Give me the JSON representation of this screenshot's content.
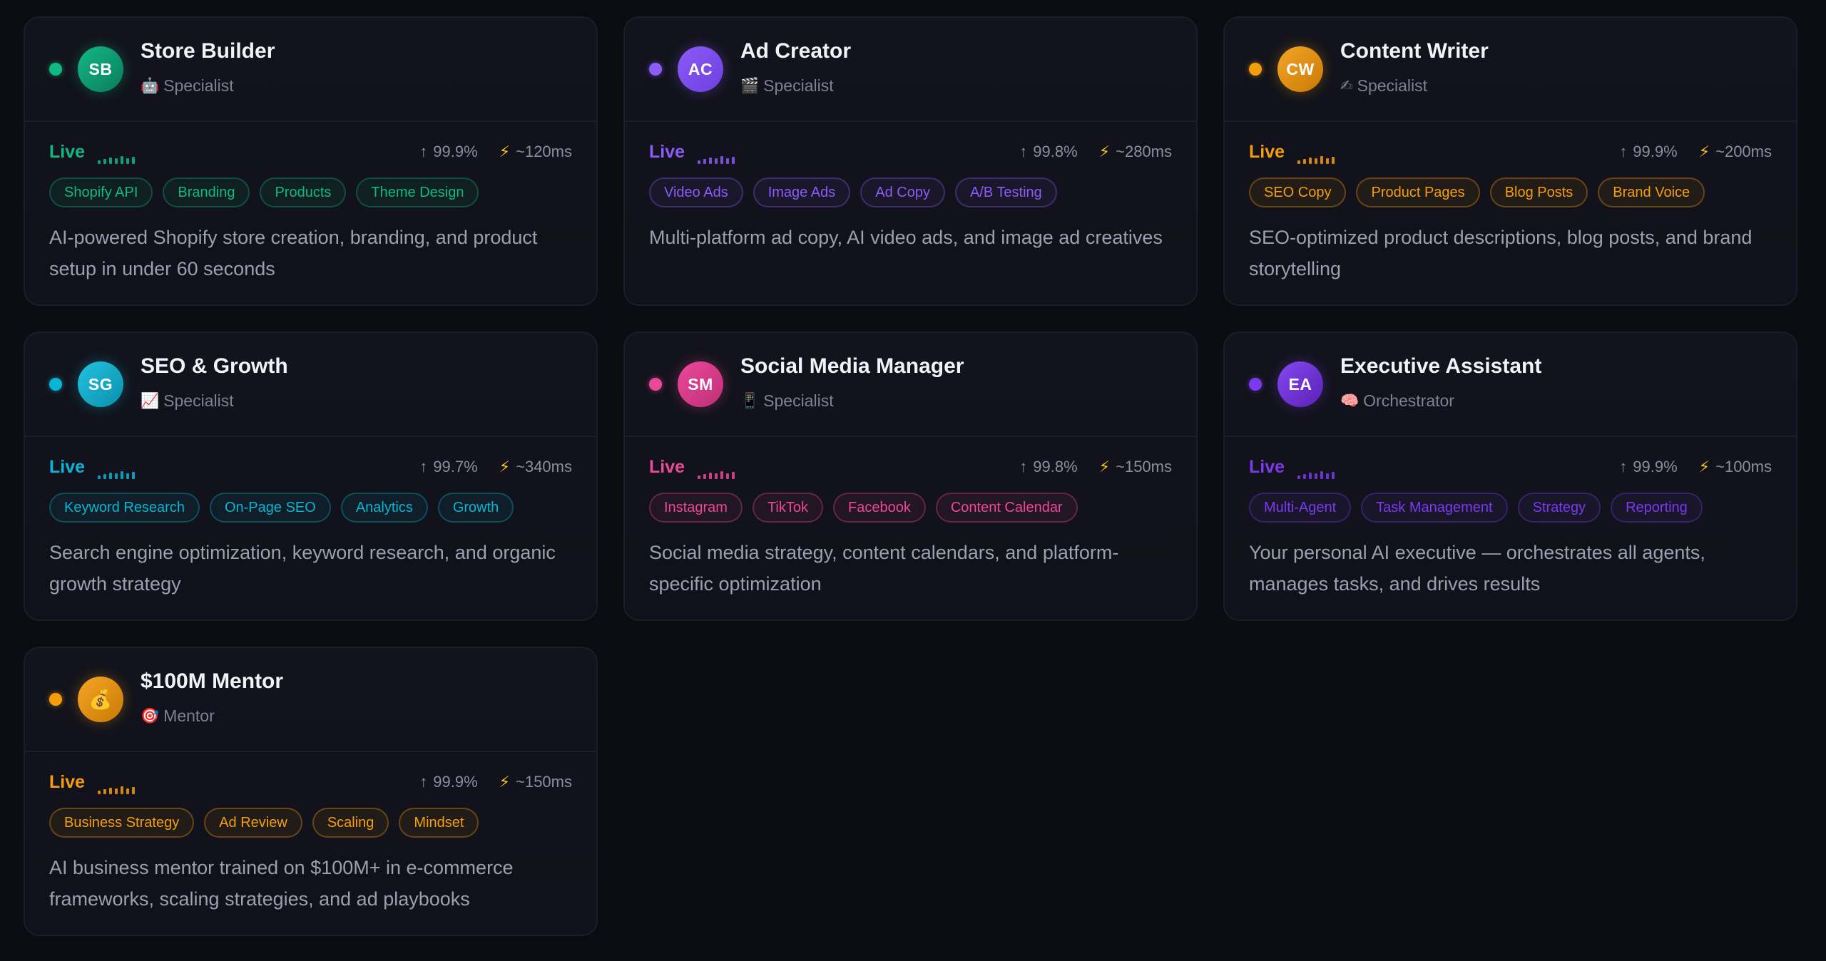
{
  "stat_live_label": "Live",
  "agents": [
    {
      "initials": "SB",
      "name": "Store Builder",
      "role": "Specialist",
      "role_icon": "robot-icon",
      "role_glyph": "🤖",
      "uptime": "99.9%",
      "latency": "~120ms",
      "accent": "#10b981",
      "avatar_from": "#12b886",
      "avatar_to": "#0a7d5c",
      "tags": [
        "Shopify API",
        "Branding",
        "Products",
        "Theme Design"
      ],
      "description": "AI-powered Shopify store creation, branding, and product setup in under 60 seconds"
    },
    {
      "initials": "AC",
      "name": "Ad Creator",
      "role": "Specialist",
      "role_icon": "clapperboard-icon",
      "role_glyph": "🎬",
      "uptime": "99.8%",
      "latency": "~280ms",
      "accent": "#8b5cf6",
      "avatar_from": "#8b5cf6",
      "avatar_to": "#6d3fe0",
      "tags": [
        "Video Ads",
        "Image Ads",
        "Ad Copy",
        "A/B Testing"
      ],
      "description": "Multi-platform ad copy, AI video ads, and image ad creatives"
    },
    {
      "initials": "CW",
      "name": "Content Writer",
      "role": "Specialist",
      "role_icon": "writing-hand-icon",
      "role_glyph": "✍",
      "uptime": "99.9%",
      "latency": "~200ms",
      "accent": "#f59e0b",
      "avatar_from": "#f5a524",
      "avatar_to": "#c97a06",
      "tags": [
        "SEO Copy",
        "Product Pages",
        "Blog Posts",
        "Brand Voice"
      ],
      "description": "SEO-optimized product descriptions, blog posts, and brand storytelling"
    },
    {
      "initials": "SG",
      "name": "SEO & Growth",
      "role": "Specialist",
      "role_icon": "chart-increasing-icon",
      "role_glyph": "📈",
      "uptime": "99.7%",
      "latency": "~340ms",
      "accent": "#06b6d4",
      "avatar_from": "#22c3dd",
      "avatar_to": "#0b8fb0",
      "tags": [
        "Keyword Research",
        "On-Page SEO",
        "Analytics",
        "Growth"
      ],
      "description": "Search engine optimization, keyword research, and organic growth strategy"
    },
    {
      "initials": "SM",
      "name": "Social Media Manager",
      "role": "Specialist",
      "role_icon": "mobile-phone-icon",
      "role_glyph": "📱",
      "uptime": "99.8%",
      "latency": "~150ms",
      "accent": "#ec4899",
      "avatar_from": "#ec4899",
      "avatar_to": "#be2f78",
      "tags": [
        "Instagram",
        "TikTok",
        "Facebook",
        "Content Calendar"
      ],
      "description": "Social media strategy, content calendars, and platform-specific optimization"
    },
    {
      "initials": "EA",
      "name": "Executive Assistant",
      "role": "Orchestrator",
      "role_icon": "brain-icon",
      "role_glyph": "🧠",
      "uptime": "99.9%",
      "latency": "~100ms",
      "accent": "#7c3aed",
      "avatar_from": "#8448f0",
      "avatar_to": "#5b21b6",
      "tags": [
        "Multi-Agent",
        "Task Management",
        "Strategy",
        "Reporting"
      ],
      "description": "Your personal AI executive — orchestrates all agents, manages tasks, and drives results"
    },
    {
      "initials": "💰",
      "name": "$100M Mentor",
      "role": "Mentor",
      "role_icon": "target-icon",
      "role_glyph": "🎯",
      "uptime": "99.9%",
      "latency": "~150ms",
      "accent": "#f59e0b",
      "avatar_from": "#f5a524",
      "avatar_to": "#c97a06",
      "tags": [
        "Business Strategy",
        "Ad Review",
        "Scaling",
        "Mindset"
      ],
      "description": "AI business mentor trained on $100M+ in e-commerce frameworks, scaling strategies, and ad playbooks"
    }
  ]
}
